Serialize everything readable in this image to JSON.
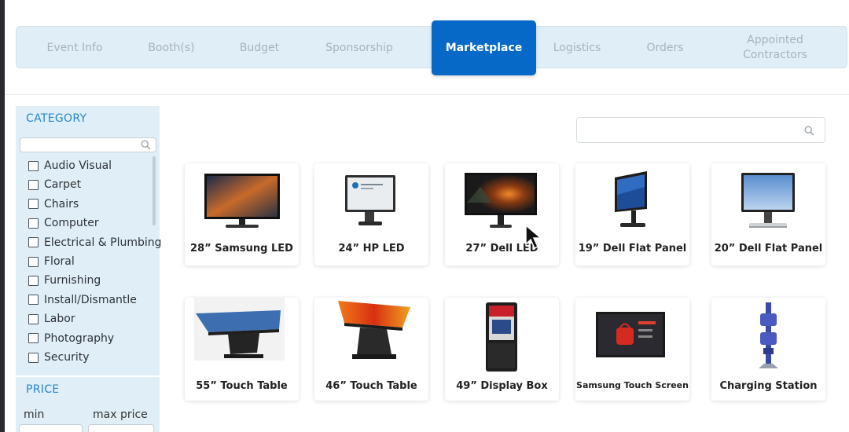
{
  "tabs": [
    {
      "label": "Event Info",
      "active": false
    },
    {
      "label": "Booth(s)",
      "active": false
    },
    {
      "label": "Budget",
      "active": false
    },
    {
      "label": "Sponsorship",
      "active": false
    },
    {
      "label": "Marketplace",
      "active": true
    },
    {
      "label": "Logistics",
      "active": false
    },
    {
      "label": "Orders",
      "active": false
    },
    {
      "label": "Appointed Contractors",
      "active": false
    }
  ],
  "sidebar": {
    "category_heading": "CATEGORY",
    "category_search_value": "",
    "categories": [
      {
        "label": "Audio Visual",
        "checked": false
      },
      {
        "label": "Carpet",
        "checked": false
      },
      {
        "label": "Chairs",
        "checked": false
      },
      {
        "label": "Computer",
        "checked": false
      },
      {
        "label": "Electrical & Plumbing",
        "checked": false
      },
      {
        "label": "Floral",
        "checked": false
      },
      {
        "label": "Furnishing",
        "checked": false
      },
      {
        "label": "Install/Dismantle",
        "checked": false
      },
      {
        "label": "Labor",
        "checked": false
      },
      {
        "label": "Photography",
        "checked": false
      },
      {
        "label": "Security",
        "checked": false
      }
    ],
    "price_heading": "PRICE",
    "min_label": "min",
    "max_label": "max price"
  },
  "search": {
    "value": "",
    "icon": "search-icon"
  },
  "products": [
    {
      "title": "28” Samsung LED",
      "icon": "samsung-monitor-image"
    },
    {
      "title": "24” HP LED",
      "icon": "hp-monitor-image"
    },
    {
      "title": "27” Dell LED",
      "icon": "dell-monitor-image"
    },
    {
      "title": "19” Dell Flat Panel",
      "icon": "dell-flat-panel-image"
    },
    {
      "title": "20” Dell Flat Panel",
      "icon": "dell-flat-panel-image"
    },
    {
      "title": "55” Touch Table",
      "icon": "touch-table-image"
    },
    {
      "title": "46” Touch Table",
      "icon": "touch-table-image"
    },
    {
      "title": "49” Display Box",
      "icon": "display-box-image"
    },
    {
      "title": "Samsung Touch Screen",
      "icon": "touch-screen-image"
    },
    {
      "title": "Charging Station",
      "icon": "charging-station-image"
    }
  ],
  "colors": {
    "accent": "#0668c7",
    "panel": "#dfeef7",
    "heading": "#2a86c9"
  }
}
